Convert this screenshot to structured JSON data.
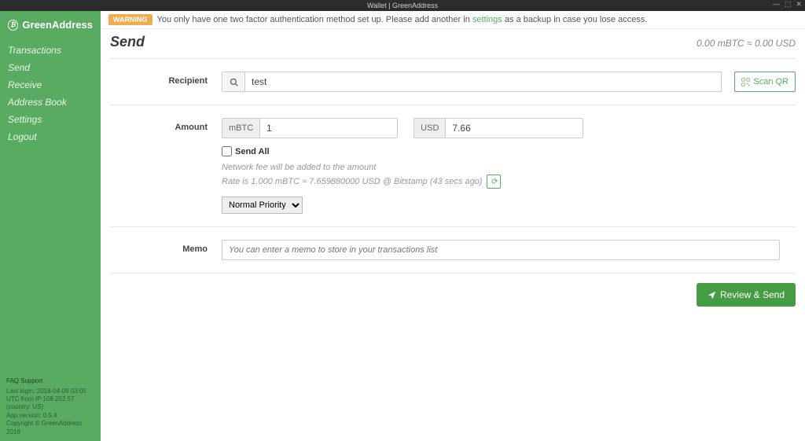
{
  "window": {
    "title": "Wallet | GreenAddress",
    "minimize": "—",
    "maximize": "⬚",
    "close": "✕"
  },
  "brand": {
    "name": "GreenAddress"
  },
  "nav": {
    "transactions": "Transactions",
    "send": "Send",
    "receive": "Receive",
    "addressBook": "Address Book",
    "settings": "Settings",
    "logout": "Logout"
  },
  "footer": {
    "faq": "FAQ  Support",
    "lastLogin": "Last login: 2018-04-09 03:05 UTC from IP 108.252.57 (country: US)",
    "appVersion": "App version: 0.5.4",
    "copyright": "Copyright © GreenAddress 2018"
  },
  "warning": {
    "badge": "WARNING",
    "before": "You only have one two factor authentication method set up. Please add another in ",
    "link": "settings",
    "after": " as a backup in case you lose access."
  },
  "page": {
    "title": "Send",
    "balance": "0.00 mBTC ≈ 0.00 USD"
  },
  "form": {
    "recipient": {
      "label": "Recipient",
      "value": "test",
      "scanQR": "Scan QR"
    },
    "amount": {
      "label": "Amount",
      "unit1": "mBTC",
      "value1": "1",
      "unit2": "USD",
      "value2": "7.66",
      "sendAll": "Send All",
      "feeNote": "Network fee will be added to the amount",
      "rate": "Rate is 1.000 mBTC ≈ 7.659880000 USD @ Bitstamp (43 secs ago)",
      "priority": "Normal Priority"
    },
    "memo": {
      "label": "Memo",
      "placeholder": "You can enter a memo to store in your transactions list"
    },
    "review": "Review & Send"
  }
}
